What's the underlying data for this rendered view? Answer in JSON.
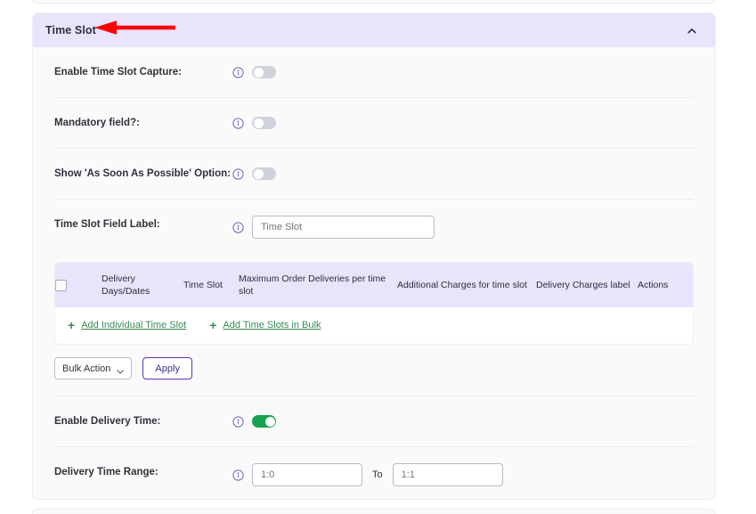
{
  "panel": {
    "title": "Time Slot",
    "collapse_icon": "chevron-up-icon"
  },
  "annotation": {
    "arrow_icon": "red-left-arrow",
    "color": "#fb0007"
  },
  "settings": {
    "enable_time_slot_capture": {
      "label": "Enable Time Slot Capture:",
      "info_icon": "info-icon",
      "toggle_state": "off"
    },
    "mandatory_field": {
      "label": "Mandatory field?:",
      "info_icon": "info-icon",
      "toggle_state": "off"
    },
    "show_asap_option": {
      "label": "Show 'As Soon As Possible' Option:",
      "info_icon": "info-icon",
      "toggle_state": "off"
    },
    "time_slot_field_label": {
      "label": "Time Slot Field Label:",
      "info_icon": "info-icon",
      "value": "Time Slot",
      "placeholder": "Time Slot"
    },
    "enable_delivery_time": {
      "label": "Enable Delivery Time:",
      "info_icon": "info-icon",
      "toggle_state": "on"
    },
    "delivery_time_range": {
      "label": "Delivery Time Range:",
      "info_icon": "info-icon",
      "from_value": "1:0",
      "from_placeholder": "1:0",
      "separator": "To",
      "to_value": "1:1",
      "to_placeholder": "1:1"
    }
  },
  "table": {
    "select_all_checkbox": "unchecked",
    "columns": [
      "Delivery Days/Dates",
      "Time Slot",
      "Maximum Order Deliveries per time slot",
      "Additional Charges for time slot",
      "Delivery Charges label",
      "Actions"
    ],
    "rows": [],
    "links": [
      {
        "plus": "+",
        "label": "Add Individual Time Slot"
      },
      {
        "plus": "+",
        "label": "Add Time Slots in Bulk"
      }
    ]
  },
  "bulk": {
    "select_value": "Bulk Action",
    "caret_icon": "chevron-down-icon",
    "apply_label": "Apply"
  },
  "colors": {
    "header_bg": "#e9e3fb",
    "accent_purple": "#5e35b1",
    "toggle_on_green": "#14a44d",
    "link_green": "#3c8a55",
    "annotation_red": "#fb0007"
  }
}
